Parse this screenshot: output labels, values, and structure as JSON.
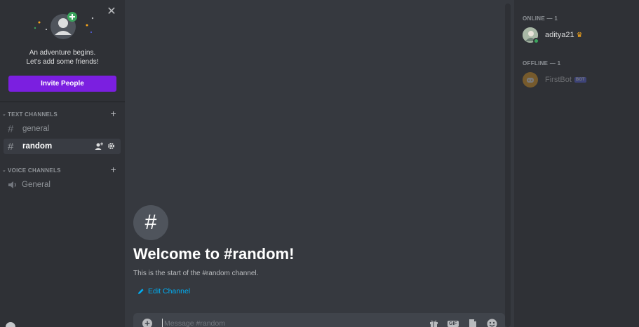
{
  "invite": {
    "line1": "An adventure begins.",
    "line2": "Let's add some friends!",
    "button": "Invite People",
    "button_color": "#7b1fe0"
  },
  "sidebar": {
    "categories": [
      {
        "label": "TEXT CHANNELS",
        "add": "+"
      },
      {
        "label": "VOICE CHANNELS",
        "add": "+"
      }
    ],
    "text_channels": [
      {
        "name": "general",
        "active": false
      },
      {
        "name": "random",
        "active": true
      }
    ],
    "voice_channels": [
      {
        "name": "General"
      }
    ]
  },
  "welcome": {
    "icon": "#",
    "title": "Welcome to #random!",
    "subtitle": "This is the start of the #random channel.",
    "edit_label": "Edit Channel"
  },
  "composer": {
    "placeholder": "Message #random",
    "gif_label": "GIF"
  },
  "members": {
    "online_header": "ONLINE — 1",
    "offline_header": "OFFLINE — 1",
    "online": [
      {
        "name": "aditya21",
        "owner": true,
        "status": "online"
      }
    ],
    "offline": [
      {
        "name": "FirstBot",
        "tag": "BOT"
      }
    ]
  },
  "colors": {
    "accent_link": "#00aff4",
    "online": "#3ba55d",
    "bot_tag": "#5865f2",
    "crown": "#faa81a"
  }
}
